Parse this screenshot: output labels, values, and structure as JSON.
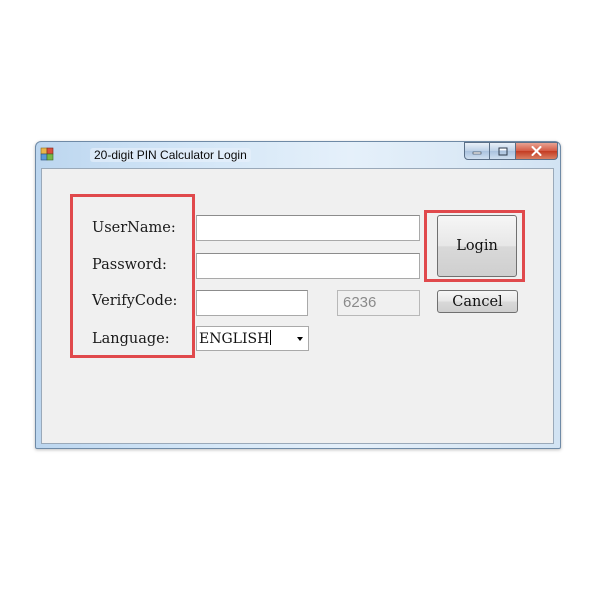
{
  "window": {
    "title": "20-digit PIN Calculator Login",
    "controls": {
      "minimize_icon": "minimize-icon",
      "maximize_icon": "maximize-icon",
      "close_icon": "close-icon"
    }
  },
  "form": {
    "username": {
      "label": "UserName:",
      "value": ""
    },
    "password": {
      "label": "Password:",
      "value": ""
    },
    "verify_code": {
      "label": "VerifyCode:",
      "value": "",
      "code": "6236"
    },
    "language": {
      "label": "Language:",
      "selected": "ENGLISH"
    }
  },
  "buttons": {
    "login": "Login",
    "cancel": "Cancel"
  },
  "colors": {
    "highlight": "#e0494c",
    "titlebar": "#c9def3",
    "client_bg": "#f0f0f0"
  }
}
